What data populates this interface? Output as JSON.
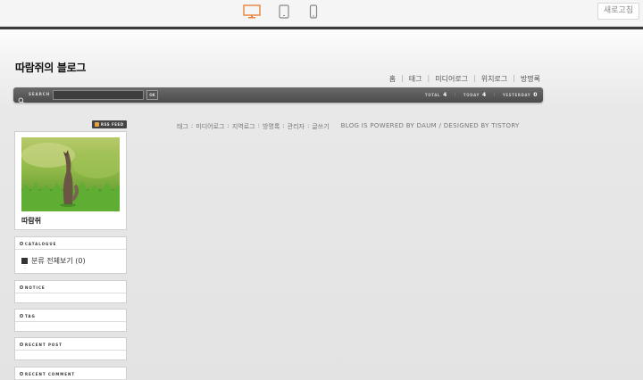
{
  "toolbar": {
    "devices": [
      "desktop-icon",
      "tablet-icon",
      "phone-icon"
    ],
    "refresh_label": "새로고침",
    "accent": "#e8813a"
  },
  "blog": {
    "title": "따람쥐의 블로그"
  },
  "topnav": [
    "홈",
    "태그",
    "미디어로그",
    "위치로그",
    "방명록"
  ],
  "search": {
    "label": "SEARCH",
    "placeholder": "",
    "button": "OK"
  },
  "stats": {
    "total_label": "TOTAL",
    "total": "4",
    "today_label": "TODAY",
    "today": "4",
    "yesterday_label": "YESTERDAY",
    "yesterday": "0"
  },
  "rss_label": "RSS FEED",
  "profile": {
    "name": "따람쥐"
  },
  "widgets": {
    "catalogue": "CATALOGUE",
    "category_item": "분류 전체보기 (0)",
    "notice": "NOTICE",
    "tag": "TAG",
    "recent_post": "RECENT POST",
    "recent_comment": "RECENT COMMENT"
  },
  "footer": {
    "links": [
      "태그",
      "미디어로그",
      "지역로그",
      "방명록",
      "관리자",
      "글쓰기"
    ],
    "credit": "BLOG IS POWERED BY DAUM / DESIGNED BY TISTORY"
  }
}
